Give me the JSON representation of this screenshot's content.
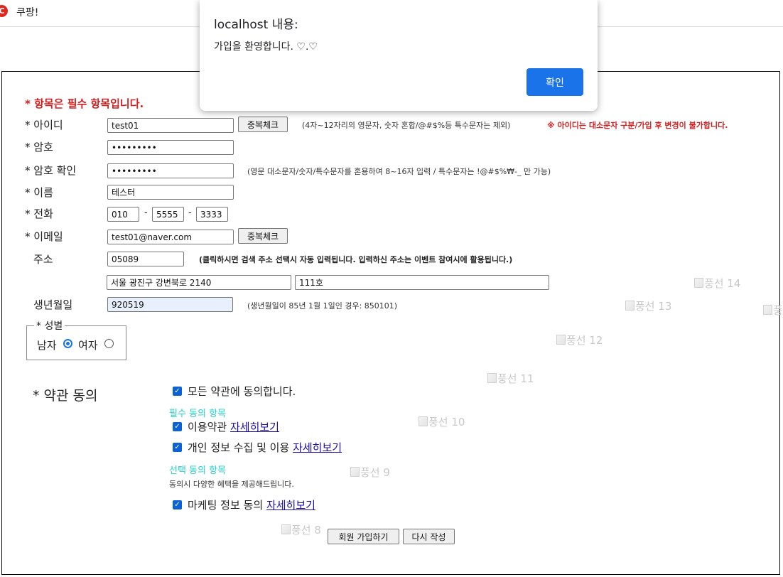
{
  "tab": {
    "favicon_letter": "C",
    "title": "쿠팡!"
  },
  "form": {
    "required_note": "* 항목은 필수 항목입니다.",
    "id": {
      "label": "* 아이디",
      "value": "test01",
      "dup_button": "중복체크",
      "hint": "(4자~12자리의 영문자, 숫자 혼합/@#$%등 특수문자는 제외)",
      "warning": "※ 아이디는 대소문자 구분/가입 후 변경이 불가합니다."
    },
    "password": {
      "label": "* 암호",
      "value": "•••••••••"
    },
    "password_confirm": {
      "label": "* 암호 확인",
      "value": "•••••••••",
      "hint": "(영문 대소문자/숫자/특수문자를 혼용하여 8~16자 입력 / 특수문자는 !@#$%₩-_ 만 가능)"
    },
    "name": {
      "label": "* 이름",
      "value": "테스터"
    },
    "phone": {
      "label": "* 전화",
      "part1": "010",
      "part2": "5555",
      "part3": "3333",
      "separator": "-"
    },
    "email": {
      "label": "* 이메일",
      "value": "test01@naver.com",
      "dup_button": "중복체크"
    },
    "address": {
      "label": "주소",
      "postcode": "05089",
      "hint": "(클릭하시면 검색 주소 선택시 자동 입력됩니다. 입력하신 주소는 이벤트 참여시에 활용됩니다.)",
      "line1": "서울 광진구 강변북로 2140",
      "line2": "111호"
    },
    "birth": {
      "label": "생년월일",
      "value": "920519",
      "hint": "(생년월일이 85년 1월 1일인 경우: 850101)"
    },
    "gender": {
      "legend": "* 성별",
      "male": "남자",
      "female": "여자",
      "selected": "남자"
    },
    "terms": {
      "title": "* 약관 동의",
      "all_agree": "모든 약관에 동의합니다.",
      "required_section": "필수 동의 항목",
      "terms_of_use": "이용약관",
      "privacy": "개인 정보 수집 및 이용",
      "detail_link": "자세히보기",
      "optional_section": "선택 동의 항목",
      "optional_desc": "동의시 다양한 혜택을 제공해드립니다.",
      "marketing": "마케팅 정보 동의",
      "checked": true
    },
    "buttons": {
      "submit": "회원 가입하기",
      "reset": "다시 작성"
    }
  },
  "balloons": [
    "풍선 14",
    "풍선 13",
    "풍선 12",
    "풍선 11",
    "풍선 10",
    "풍선 9",
    "풍선 8",
    "풍"
  ],
  "dialog": {
    "title": "localhost 내용:",
    "message": "가입을 환영합니다. ♡.♡",
    "ok_button": "확인"
  },
  "colors": {
    "required_red": "#d21e1e",
    "section_cyan": "#22d3c9",
    "link_blue": "#1a0dab",
    "dialog_button": "#1a73e8",
    "favicon": "#e0281f"
  }
}
